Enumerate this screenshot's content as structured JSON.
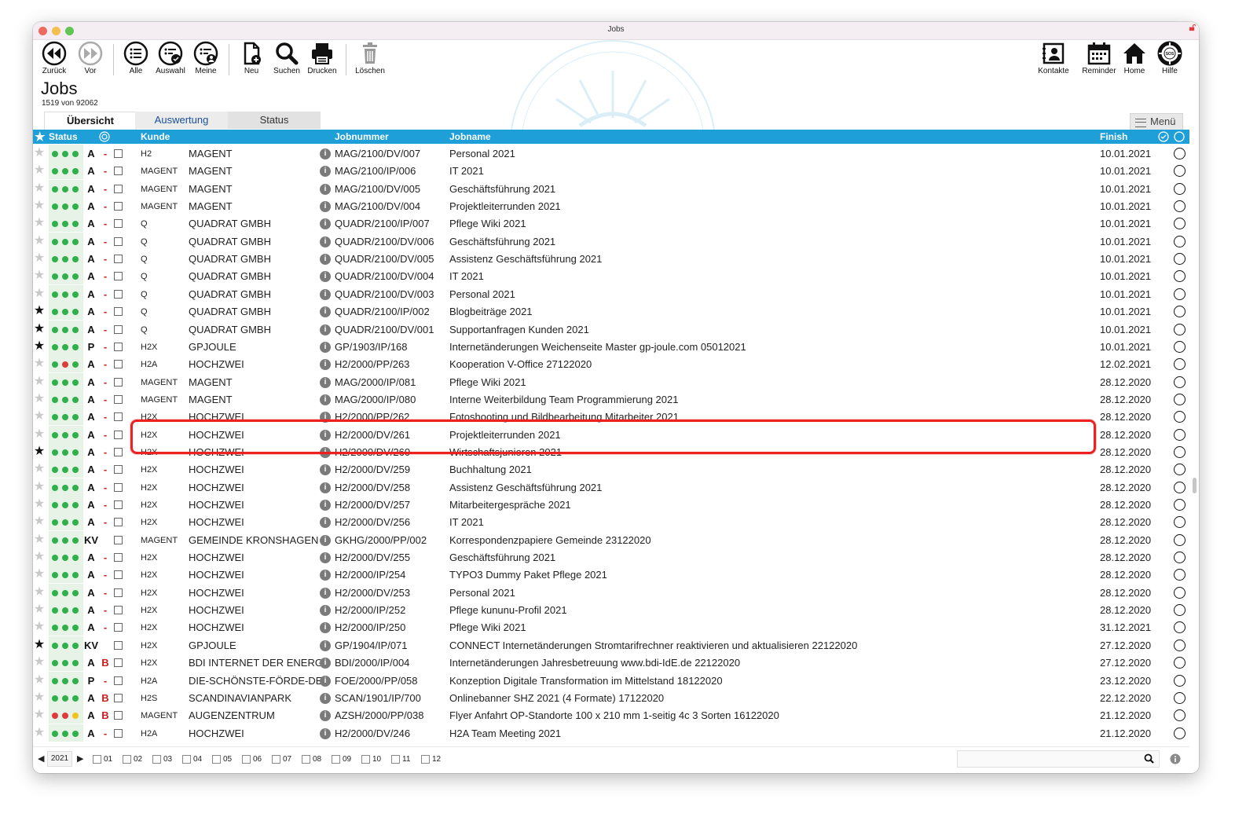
{
  "window": {
    "title": "Jobs"
  },
  "toolbar": {
    "back": "Zurück",
    "forward": "Vor",
    "all": "Alle",
    "selection": "Auswahl",
    "mine": "Meine",
    "new": "Neu",
    "search": "Suchen",
    "print": "Drucken",
    "delete": "Löschen",
    "contacts": "Kontakte",
    "reminder": "Reminder",
    "home": "Home",
    "help": "Hilfe"
  },
  "page": {
    "title": "Jobs",
    "count": "1519 von 92062"
  },
  "tabs": [
    "Übersicht",
    "Auswertung",
    "Status"
  ],
  "menu_label": "Menü",
  "columns": {
    "status": "Status",
    "kunde": "Kunde",
    "jobnummer": "Jobnummer",
    "jobname": "Jobname",
    "finish": "Finish"
  },
  "colors": {
    "header": "#1e9fd8",
    "green": "#2fb04a",
    "red": "#e03b3b",
    "yellow": "#f0c31e",
    "highlight": "#ec2222"
  },
  "rows": [
    {
      "star": false,
      "dots": [
        "g",
        "g",
        "g"
      ],
      "code": "A",
      "flag": "-",
      "short": "H2",
      "kunde": "MAGENT",
      "job": "MAG/2100/DV/007",
      "name": "Personal 2021",
      "finish": "10.01.2021"
    },
    {
      "star": false,
      "dots": [
        "g",
        "g",
        "g"
      ],
      "code": "A",
      "flag": "-",
      "short": "MAGENT",
      "kunde": "MAGENT",
      "job": "MAG/2100/IP/006",
      "name": "IT 2021",
      "finish": "10.01.2021"
    },
    {
      "star": false,
      "dots": [
        "g",
        "g",
        "g"
      ],
      "code": "A",
      "flag": "-",
      "short": "MAGENT",
      "kunde": "MAGENT",
      "job": "MAG/2100/DV/005",
      "name": "Geschäftsführung 2021",
      "finish": "10.01.2021"
    },
    {
      "star": false,
      "dots": [
        "g",
        "g",
        "g"
      ],
      "code": "A",
      "flag": "-",
      "short": "MAGENT",
      "kunde": "MAGENT",
      "job": "MAG/2100/DV/004",
      "name": "Projektleiterrunden 2021",
      "finish": "10.01.2021"
    },
    {
      "star": false,
      "dots": [
        "g",
        "g",
        "g"
      ],
      "code": "A",
      "flag": "-",
      "short": "Q",
      "kunde": "QUADRAT GMBH",
      "job": "QUADR/2100/IP/007",
      "name": "Pflege Wiki 2021",
      "finish": "10.01.2021"
    },
    {
      "star": false,
      "dots": [
        "g",
        "g",
        "g"
      ],
      "code": "A",
      "flag": "-",
      "short": "Q",
      "kunde": "QUADRAT GMBH",
      "job": "QUADR/2100/DV/006",
      "name": "Geschäftsführung 2021",
      "finish": "10.01.2021"
    },
    {
      "star": false,
      "dots": [
        "g",
        "g",
        "g"
      ],
      "code": "A",
      "flag": "-",
      "short": "Q",
      "kunde": "QUADRAT GMBH",
      "job": "QUADR/2100/DV/005",
      "name": "Assistenz Geschäftsführung 2021",
      "finish": "10.01.2021"
    },
    {
      "star": false,
      "dots": [
        "g",
        "g",
        "g"
      ],
      "code": "A",
      "flag": "-",
      "short": "Q",
      "kunde": "QUADRAT GMBH",
      "job": "QUADR/2100/DV/004",
      "name": "IT 2021",
      "finish": "10.01.2021"
    },
    {
      "star": false,
      "dots": [
        "g",
        "g",
        "g"
      ],
      "code": "A",
      "flag": "-",
      "short": "Q",
      "kunde": "QUADRAT GMBH",
      "job": "QUADR/2100/DV/003",
      "name": "Personal 2021",
      "finish": "10.01.2021"
    },
    {
      "star": true,
      "dots": [
        "g",
        "g",
        "g"
      ],
      "code": "A",
      "flag": "-",
      "short": "Q",
      "kunde": "QUADRAT GMBH",
      "job": "QUADR/2100/IP/002",
      "name": "Blogbeiträge 2021",
      "finish": "10.01.2021"
    },
    {
      "star": true,
      "dots": [
        "g",
        "g",
        "g"
      ],
      "code": "A",
      "flag": "-",
      "short": "Q",
      "kunde": "QUADRAT GMBH",
      "job": "QUADR/2100/DV/001",
      "name": "Supportanfragen Kunden 2021",
      "finish": "10.01.2021"
    },
    {
      "star": true,
      "dots": [
        "g",
        "g",
        "g"
      ],
      "code": "P",
      "flag": "-",
      "short": "H2X",
      "kunde": "GPJOULE",
      "job": "GP/1903/IP/168",
      "name": "Internetänderungen Weichenseite Master gp-joule.com 05012021",
      "finish": "10.01.2021"
    },
    {
      "star": false,
      "dots": [
        "g",
        "r",
        "g"
      ],
      "code": "A",
      "flag": "-",
      "short": "H2A",
      "kunde": "HOCHZWEI",
      "job": "H2/2000/PP/263",
      "name": "Kooperation V-Office 27122020",
      "finish": "12.02.2021"
    },
    {
      "star": false,
      "dots": [
        "g",
        "g",
        "g"
      ],
      "code": "A",
      "flag": "-",
      "short": "MAGENT",
      "kunde": "MAGENT",
      "job": "MAG/2000/IP/081",
      "name": "Pflege Wiki 2021",
      "finish": "28.12.2020"
    },
    {
      "star": false,
      "dots": [
        "g",
        "g",
        "g"
      ],
      "code": "A",
      "flag": "-",
      "short": "MAGENT",
      "kunde": "MAGENT",
      "job": "MAG/2000/IP/080",
      "name": "Interne Weiterbildung Team Programmierung 2021",
      "finish": "28.12.2020"
    },
    {
      "star": false,
      "dots": [
        "g",
        "g",
        "g"
      ],
      "code": "A",
      "flag": "-",
      "short": "H2X",
      "kunde": "HOCHZWEI",
      "job": "H2/2000/PP/262",
      "name": "Fotoshooting und Bildbearbeitung Mitarbeiter 2021",
      "finish": "28.12.2020"
    },
    {
      "star": false,
      "dots": [
        "g",
        "g",
        "g"
      ],
      "code": "A",
      "flag": "-",
      "short": "H2X",
      "kunde": "HOCHZWEI",
      "job": "H2/2000/DV/261",
      "name": "Projektleiterrunden 2021",
      "finish": "28.12.2020"
    },
    {
      "star": true,
      "dots": [
        "g",
        "g",
        "g"
      ],
      "code": "A",
      "flag": "-",
      "short": "H2X",
      "kunde": "HOCHZWEI",
      "job": "H2/2000/DV/260",
      "name": "Wirtschaftsjunioren 2021",
      "finish": "28.12.2020"
    },
    {
      "star": false,
      "dots": [
        "g",
        "g",
        "g"
      ],
      "code": "A",
      "flag": "-",
      "short": "H2X",
      "kunde": "HOCHZWEI",
      "job": "H2/2000/DV/259",
      "name": "Buchhaltung 2021",
      "finish": "28.12.2020"
    },
    {
      "star": false,
      "dots": [
        "g",
        "g",
        "g"
      ],
      "code": "A",
      "flag": "-",
      "short": "H2X",
      "kunde": "HOCHZWEI",
      "job": "H2/2000/DV/258",
      "name": "Assistenz Geschäftsführung 2021",
      "finish": "28.12.2020"
    },
    {
      "star": false,
      "dots": [
        "g",
        "g",
        "g"
      ],
      "code": "A",
      "flag": "-",
      "short": "H2X",
      "kunde": "HOCHZWEI",
      "job": "H2/2000/DV/257",
      "name": "Mitarbeitergespräche 2021",
      "finish": "28.12.2020"
    },
    {
      "star": false,
      "dots": [
        "g",
        "g",
        "g"
      ],
      "code": "A",
      "flag": "-",
      "short": "H2X",
      "kunde": "HOCHZWEI",
      "job": "H2/2000/DV/256",
      "name": "IT 2021",
      "finish": "28.12.2020"
    },
    {
      "star": false,
      "dots": [
        "g",
        "g",
        "g"
      ],
      "code": "KV",
      "flag": "",
      "short": "MAGENT",
      "kunde": "GEMEINDE KRONSHAGEN",
      "job": "GKHG/2000/PP/002",
      "name": "Korrespondenzpapiere Gemeinde 23122020",
      "finish": "28.12.2020"
    },
    {
      "star": false,
      "dots": [
        "g",
        "g",
        "g"
      ],
      "code": "A",
      "flag": "-",
      "short": "H2X",
      "kunde": "HOCHZWEI",
      "job": "H2/2000/DV/255",
      "name": "Geschäftsführung 2021",
      "finish": "28.12.2020"
    },
    {
      "star": false,
      "dots": [
        "g",
        "g",
        "g"
      ],
      "code": "A",
      "flag": "-",
      "short": "H2X",
      "kunde": "HOCHZWEI",
      "job": "H2/2000/IP/254",
      "name": "TYPO3 Dummy Paket Pflege 2021",
      "finish": "28.12.2020"
    },
    {
      "star": false,
      "dots": [
        "g",
        "g",
        "g"
      ],
      "code": "A",
      "flag": "-",
      "short": "H2X",
      "kunde": "HOCHZWEI",
      "job": "H2/2000/DV/253",
      "name": "Personal 2021",
      "finish": "28.12.2020"
    },
    {
      "star": false,
      "dots": [
        "g",
        "g",
        "g"
      ],
      "code": "A",
      "flag": "-",
      "short": "H2X",
      "kunde": "HOCHZWEI",
      "job": "H2/2000/IP/252",
      "name": "Pflege kununu-Profil 2021",
      "finish": "28.12.2020"
    },
    {
      "star": false,
      "dots": [
        "g",
        "g",
        "g"
      ],
      "code": "A",
      "flag": "-",
      "short": "H2X",
      "kunde": "HOCHZWEI",
      "job": "H2/2000/IP/250",
      "name": "Pflege Wiki 2021",
      "finish": "31.12.2021"
    },
    {
      "star": true,
      "dots": [
        "g",
        "g",
        "g"
      ],
      "code": "KV",
      "flag": "",
      "short": "H2X",
      "kunde": "GPJOULE",
      "job": "GP/1904/IP/071",
      "name": "CONNECT Internetänderungen Stromtarifrechner reaktivieren und aktualisieren 22122020",
      "finish": "27.12.2020"
    },
    {
      "star": false,
      "dots": [
        "g",
        "g",
        "g"
      ],
      "code": "A",
      "flag": "B",
      "short": "H2X",
      "kunde": "BDI INTERNET DER ENERGIE",
      "job": "BDI/2000/IP/004",
      "name": "Internetänderungen Jahresbetreuung www.bdi-IdE.de 22122020",
      "finish": "27.12.2020"
    },
    {
      "star": false,
      "dots": [
        "g",
        "g",
        "g"
      ],
      "code": "P",
      "flag": "-",
      "short": "H2A",
      "kunde": "DIE-SCHÖNSTE-FÖRDE-DE",
      "job": "FOE/2000/PP/058",
      "name": "Konzeption Digitale Transformation im Mittelstand 18122020",
      "finish": "23.12.2020"
    },
    {
      "star": false,
      "dots": [
        "g",
        "g",
        "g"
      ],
      "code": "A",
      "flag": "B",
      "short": "H2S",
      "kunde": "SCANDINAVIANPARK",
      "job": "SCAN/1901/IP/700",
      "name": "Onlinebanner SHZ 2021 (4 Formate) 17122020",
      "finish": "22.12.2020"
    },
    {
      "star": false,
      "dots": [
        "r",
        "r",
        "y"
      ],
      "code": "A",
      "flag": "B",
      "short": "MAGENT",
      "kunde": "AUGENZENTRUM",
      "job": "AZSH/2000/PP/038",
      "name": "Flyer Anfahrt OP-Standorte 100 x 210 mm 1-seitig 4c 3 Sorten 16122020",
      "finish": "21.12.2020"
    },
    {
      "star": false,
      "dots": [
        "g",
        "g",
        "g"
      ],
      "code": "A",
      "flag": "-",
      "short": "H2A",
      "kunde": "HOCHZWEI",
      "job": "H2/2000/DV/246",
      "name": "H2A Team Meeting 2021",
      "finish": "21.12.2020"
    }
  ],
  "footer": {
    "year": "2021",
    "months": [
      "01",
      "02",
      "03",
      "04",
      "05",
      "06",
      "07",
      "08",
      "09",
      "10",
      "11",
      "12"
    ]
  }
}
